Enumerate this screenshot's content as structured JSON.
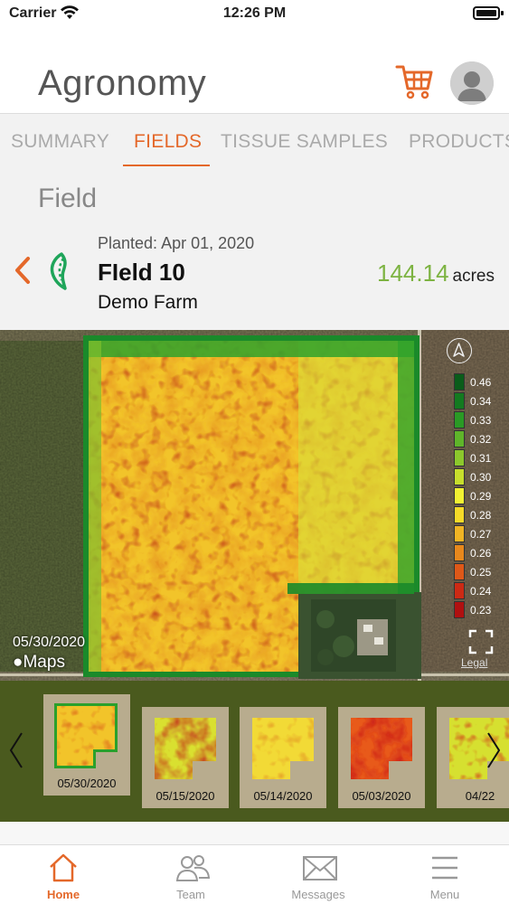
{
  "status_bar": {
    "carrier": "Carrier",
    "time": "12:26 PM"
  },
  "header": {
    "title": "Agronomy",
    "cart_icon": "cart-icon",
    "avatar_icon": "user-avatar-icon"
  },
  "tabs": [
    {
      "label": "SUMMARY",
      "active": false
    },
    {
      "label": "FIELDS",
      "active": true
    },
    {
      "label": "TISSUE SAMPLES",
      "active": false
    },
    {
      "label": "PRODUCTS",
      "active": false
    }
  ],
  "field": {
    "section_label": "Field",
    "planted_label": "Planted:",
    "planted_date": "Apr 01, 2020",
    "name": "FIeld 10",
    "farm": "Demo Farm",
    "acres": "144.14",
    "acres_unit": "acres"
  },
  "map": {
    "date": "05/30/2020",
    "provider": "Maps",
    "legal": "Legal",
    "legend": [
      {
        "value": "0.46",
        "color": "#0a5c1a"
      },
      {
        "value": "0.34",
        "color": "#137a20"
      },
      {
        "value": "0.33",
        "color": "#2a9a25"
      },
      {
        "value": "0.32",
        "color": "#5fb52a"
      },
      {
        "value": "0.31",
        "color": "#8cc82c"
      },
      {
        "value": "0.30",
        "color": "#c7de2c"
      },
      {
        "value": "0.29",
        "color": "#f2f232"
      },
      {
        "value": "0.28",
        "color": "#f6da28"
      },
      {
        "value": "0.27",
        "color": "#f0b424"
      },
      {
        "value": "0.26",
        "color": "#e8881c"
      },
      {
        "value": "0.25",
        "color": "#de5818"
      },
      {
        "value": "0.24",
        "color": "#cc2a14"
      },
      {
        "value": "0.23",
        "color": "#b01010"
      }
    ]
  },
  "thumbnails": [
    {
      "date": "05/30/2020"
    },
    {
      "date": "05/15/2020"
    },
    {
      "date": "05/14/2020"
    },
    {
      "date": "05/03/2020"
    },
    {
      "date": "04/22"
    }
  ],
  "tab_bar": [
    {
      "label": "Home",
      "icon": "home-icon",
      "active": true
    },
    {
      "label": "Team",
      "icon": "team-icon",
      "active": false
    },
    {
      "label": "Messages",
      "icon": "envelope-icon",
      "active": false
    },
    {
      "label": "Menu",
      "icon": "hamburger-icon",
      "active": false
    }
  ],
  "colors": {
    "accent": "#e4682a",
    "acres_green": "#7db342"
  }
}
